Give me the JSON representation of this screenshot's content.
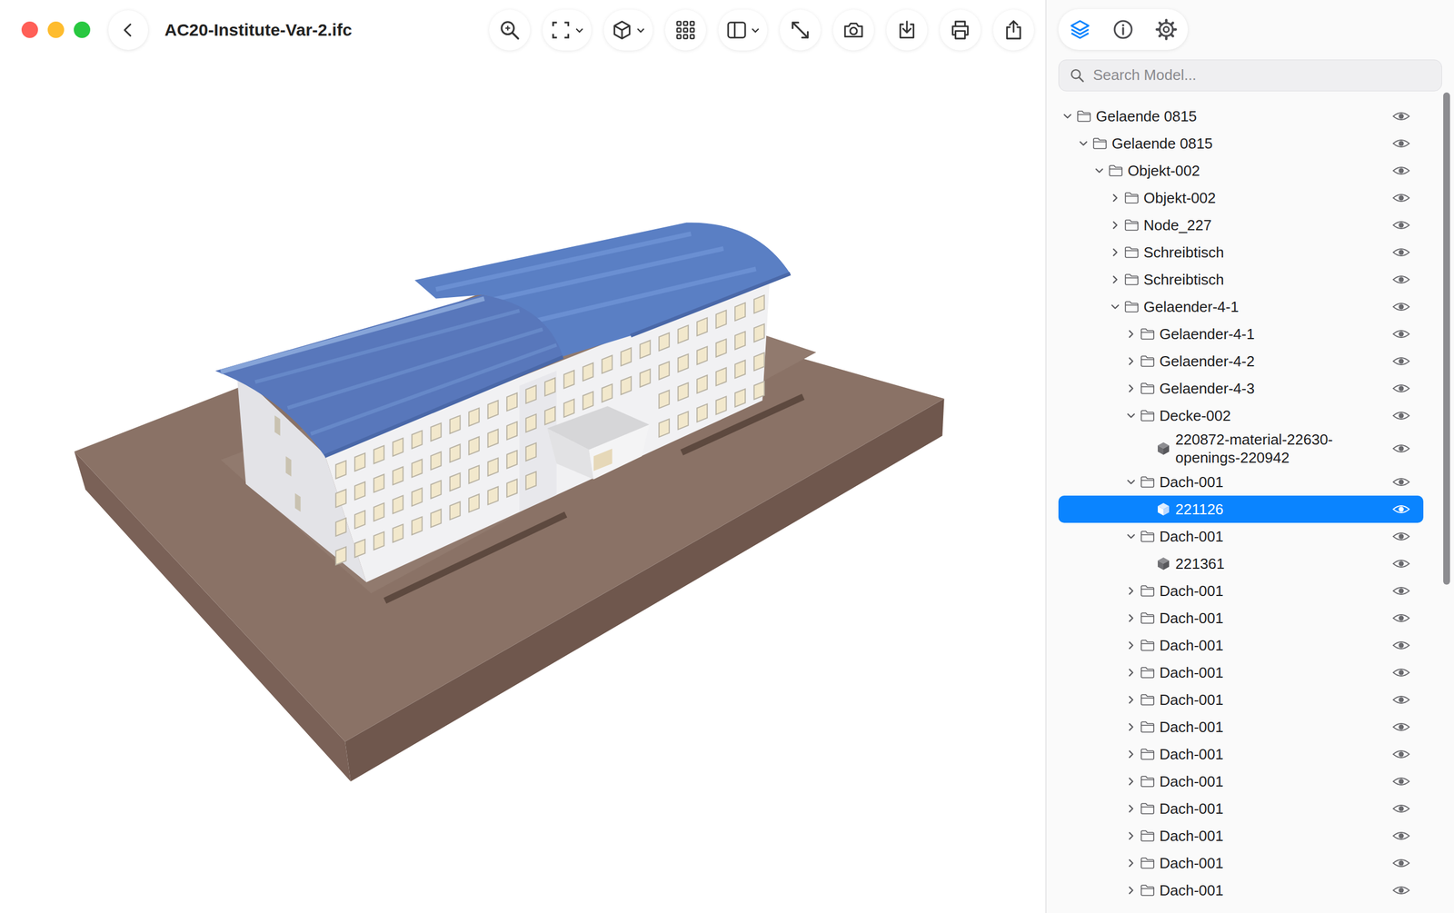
{
  "window": {
    "title": "AC20-Institute-Var-2.ifc"
  },
  "panel_tabs": [
    {
      "selected": true
    },
    {
      "selected": false
    },
    {
      "selected": false
    }
  ],
  "search": {
    "placeholder": "Search Model..."
  },
  "tree": {
    "scroll": {
      "level": 0.6
    },
    "items": [
      {
        "label": "Gelaende 0815",
        "depth": 0,
        "kind": "folder",
        "expanded": true,
        "selected": false,
        "visible": true
      },
      {
        "label": "Gelaende 0815",
        "depth": 1,
        "kind": "folder",
        "expanded": true,
        "selected": false,
        "visible": true
      },
      {
        "label": "Objekt-002",
        "depth": 2,
        "kind": "folder",
        "expanded": true,
        "selected": false,
        "visible": true
      },
      {
        "label": "Objekt-002",
        "depth": 3,
        "kind": "folder",
        "expanded": false,
        "selected": false,
        "visible": true
      },
      {
        "label": "Node_227",
        "depth": 3,
        "kind": "folder",
        "expanded": false,
        "selected": false,
        "visible": true
      },
      {
        "label": "Schreibtisch",
        "depth": 3,
        "kind": "folder",
        "expanded": false,
        "selected": false,
        "visible": true
      },
      {
        "label": "Schreibtisch",
        "depth": 3,
        "kind": "folder",
        "expanded": false,
        "selected": false,
        "visible": true
      },
      {
        "label": "Gelaender-4-1",
        "depth": 3,
        "kind": "folder",
        "expanded": true,
        "selected": false,
        "visible": true
      },
      {
        "label": "Gelaender-4-1",
        "depth": 4,
        "kind": "folder",
        "expanded": false,
        "selected": false,
        "visible": true
      },
      {
        "label": "Gelaender-4-2",
        "depth": 4,
        "kind": "folder",
        "expanded": false,
        "selected": false,
        "visible": true
      },
      {
        "label": "Gelaender-4-3",
        "depth": 4,
        "kind": "folder",
        "expanded": false,
        "selected": false,
        "visible": true
      },
      {
        "label": "Decke-002",
        "depth": 4,
        "kind": "folder",
        "expanded": true,
        "selected": false,
        "visible": true
      },
      {
        "label": "220872-material-22630-openings-220942",
        "depth": 5,
        "kind": "object",
        "expanded": false,
        "selected": false,
        "visible": true
      },
      {
        "label": "Dach-001",
        "depth": 4,
        "kind": "folder",
        "expanded": true,
        "selected": false,
        "visible": true
      },
      {
        "label": "221126",
        "depth": 5,
        "kind": "object",
        "expanded": false,
        "selected": true,
        "visible": true
      },
      {
        "label": "Dach-001",
        "depth": 4,
        "kind": "folder",
        "expanded": true,
        "selected": false,
        "visible": true
      },
      {
        "label": "221361",
        "depth": 5,
        "kind": "object",
        "expanded": false,
        "selected": false,
        "visible": true
      },
      {
        "label": "Dach-001",
        "depth": 4,
        "kind": "folder",
        "expanded": false,
        "selected": false,
        "visible": true
      },
      {
        "label": "Dach-001",
        "depth": 4,
        "kind": "folder",
        "expanded": false,
        "selected": false,
        "visible": true
      },
      {
        "label": "Dach-001",
        "depth": 4,
        "kind": "folder",
        "expanded": false,
        "selected": false,
        "visible": true
      },
      {
        "label": "Dach-001",
        "depth": 4,
        "kind": "folder",
        "expanded": false,
        "selected": false,
        "visible": true
      },
      {
        "label": "Dach-001",
        "depth": 4,
        "kind": "folder",
        "expanded": false,
        "selected": false,
        "visible": true
      },
      {
        "label": "Dach-001",
        "depth": 4,
        "kind": "folder",
        "expanded": false,
        "selected": false,
        "visible": true
      },
      {
        "label": "Dach-001",
        "depth": 4,
        "kind": "folder",
        "expanded": false,
        "selected": false,
        "visible": true
      },
      {
        "label": "Dach-001",
        "depth": 4,
        "kind": "folder",
        "expanded": false,
        "selected": false,
        "visible": true
      },
      {
        "label": "Dach-001",
        "depth": 4,
        "kind": "folder",
        "expanded": false,
        "selected": false,
        "visible": true
      },
      {
        "label": "Dach-001",
        "depth": 4,
        "kind": "folder",
        "expanded": false,
        "selected": false,
        "visible": true
      },
      {
        "label": "Dach-001",
        "depth": 4,
        "kind": "folder",
        "expanded": false,
        "selected": false,
        "visible": true
      },
      {
        "label": "Dach-001",
        "depth": 4,
        "kind": "folder",
        "expanded": false,
        "selected": false,
        "visible": true
      }
    ]
  }
}
